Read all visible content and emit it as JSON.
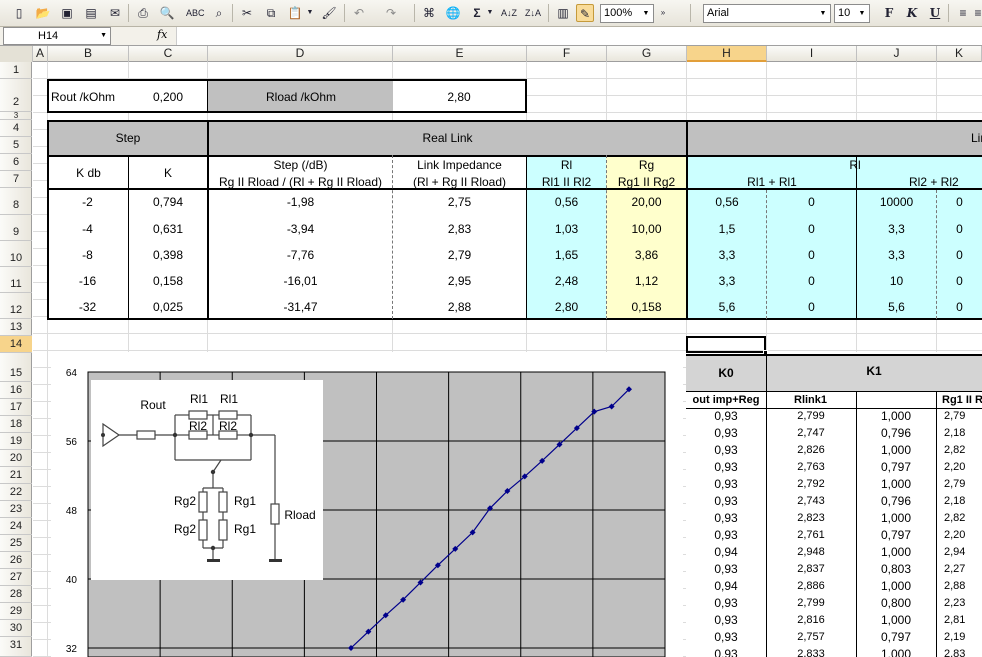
{
  "toolbar": {
    "zoom": "100%",
    "font": "Arial",
    "font_size": "10",
    "bold": "F",
    "italic": "K",
    "underline": "U"
  },
  "formula_bar": {
    "name_box": "H14",
    "fx": "fx",
    "formula": ""
  },
  "columns": [
    "A",
    "B",
    "C",
    "D",
    "E",
    "F",
    "G",
    "H",
    "I",
    "J",
    "K"
  ],
  "rows": [
    "1",
    "2",
    "3",
    "4",
    "5",
    "6",
    "7",
    "8",
    "9",
    "10",
    "11",
    "12",
    "13",
    "14",
    "15",
    "16",
    "17",
    "18",
    "19",
    "20",
    "21",
    "22",
    "23",
    "24",
    "25",
    "26",
    "27",
    "28",
    "29",
    "30",
    "31"
  ],
  "params": {
    "rout_label": "Rout   /kOhm",
    "rout_value": "0,200",
    "rload_label": "Rload    /kOhm",
    "rload_value": "2,80"
  },
  "table": {
    "step": "Step",
    "real_link": "Real Link",
    "link": "Link",
    "k_db": "K db",
    "k": "K",
    "step_db_1": "Step (/dB)",
    "step_db_2": "Rg II Rload / (Rl + Rg II Rload)",
    "link_imp_1": "Link Impedance",
    "link_imp_2": "(Rl + Rg II Rload)",
    "rl_1": "Rl",
    "rl_2": "Rl1 II Rl2",
    "rg_1": "Rg",
    "rg_2": "Rg1 II Rg2",
    "rl_link": "Rl",
    "rl_sum1": "Rl1 + Rl1",
    "rl_sum2": "Rl2 + Rl2",
    "rows": [
      [
        "-2",
        "0,794",
        "-1,98",
        "2,75",
        "0,56",
        "20,00",
        "0,56",
        "0",
        "10000",
        "0"
      ],
      [
        "-4",
        "0,631",
        "-3,94",
        "2,83",
        "1,03",
        "10,00",
        "1,5",
        "0",
        "3,3",
        "0"
      ],
      [
        "-8",
        "0,398",
        "-7,76",
        "2,79",
        "1,65",
        "3,86",
        "3,3",
        "0",
        "3,3",
        "0"
      ],
      [
        "-16",
        "0,158",
        "-16,01",
        "2,95",
        "2,48",
        "1,12",
        "3,3",
        "0",
        "10",
        "0"
      ],
      [
        "-32",
        "0,025",
        "-31,47",
        "2,88",
        "2,80",
        "0,158",
        "5,6",
        "0",
        "5,6",
        "0"
      ]
    ]
  },
  "ktable": {
    "k0": "K0",
    "k1": "K1",
    "col_h": "out imp+Reg",
    "col_i": "Rlink1",
    "col_k": "Rg1 II R",
    "rows": [
      [
        "0,93",
        "2,799",
        "1,000",
        "2,79"
      ],
      [
        "0,93",
        "2,747",
        "0,796",
        "2,18"
      ],
      [
        "0,93",
        "2,826",
        "1,000",
        "2,82"
      ],
      [
        "0,93",
        "2,763",
        "0,797",
        "2,20"
      ],
      [
        "0,93",
        "2,792",
        "1,000",
        "2,79"
      ],
      [
        "0,93",
        "2,743",
        "0,796",
        "2,18"
      ],
      [
        "0,93",
        "2,823",
        "1,000",
        "2,82"
      ],
      [
        "0,93",
        "2,761",
        "0,797",
        "2,20"
      ],
      [
        "0,94",
        "2,948",
        "1,000",
        "2,94"
      ],
      [
        "0,93",
        "2,837",
        "0,803",
        "2,27"
      ],
      [
        "0,94",
        "2,886",
        "1,000",
        "2,88"
      ],
      [
        "0,93",
        "2,799",
        "0,800",
        "2,23"
      ],
      [
        "0,93",
        "2,816",
        "1,000",
        "2,81"
      ],
      [
        "0,93",
        "2,757",
        "0,797",
        "2,19"
      ],
      [
        "0,93",
        "2,833",
        "1,000",
        "2,83"
      ]
    ]
  },
  "chart_data": {
    "type": "line",
    "yticks": [
      "64",
      "56",
      "48",
      "40",
      "32"
    ],
    "ylim": [
      30,
      64
    ],
    "x": [
      1,
      2,
      3,
      4,
      5,
      6,
      7,
      8,
      9,
      10,
      11,
      12,
      13,
      14,
      15,
      16,
      17
    ],
    "y": [
      32,
      33.9,
      35.8,
      37.6,
      39.6,
      41.6,
      43.5,
      45.4,
      48.2,
      50.2,
      51.9,
      53.7,
      55.6,
      57.5,
      59.4,
      60,
      62
    ],
    "color": "#00008b"
  },
  "circuit": {
    "labels": [
      "Rout",
      "Rl1",
      "Rl1",
      "Rl2",
      "Rl2",
      "Rg2",
      "Rg1",
      "Rg2",
      "Rg1",
      "Rload"
    ]
  }
}
